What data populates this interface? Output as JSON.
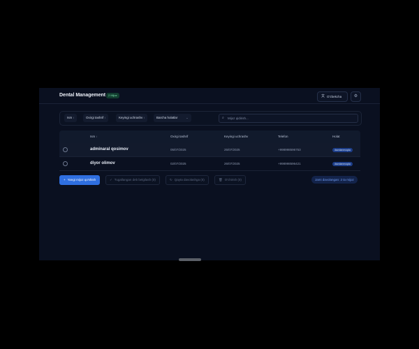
{
  "header": {
    "title": "Dental Management",
    "badge": "2 Mijoz",
    "language_label": "O'zbekcha",
    "language_icon": "translate-icon",
    "settings_icon": "gear-icon"
  },
  "filters": {
    "buttons": [
      "Ism",
      "Oxirgi tashrif",
      "Keyingi uchrashv"
    ],
    "status_select": "Barcha holatlar",
    "search_placeholder": "Mijoz qidirish..."
  },
  "table": {
    "headers": [
      "Ism",
      "Oxirgi tashrif",
      "Keyingi uchrashv",
      "Telefon",
      "Holat"
    ],
    "rows": [
      {
        "name": "adminaral qosimov",
        "last_visit": "05/07/2025",
        "next_visit": "25/07/2025",
        "phone": "+998998596753",
        "status": "davolanmoqda"
      },
      {
        "name": "diyor olimov",
        "last_visit": "02/07/2025",
        "next_visit": "26/07/2025",
        "phone": "+998998596421",
        "status": "davolanmoqda"
      }
    ]
  },
  "actions": {
    "add": "Yangi mijoz qo'shish",
    "finish": "Tugallangan deb belgilash (0)",
    "retreat": "Qayta davolashga (0)",
    "delete": "O'chirish (0)",
    "total": "Jami davolangan: 2 ta mijoz"
  },
  "colors": {
    "accent": "#2f6fe0",
    "background": "#0a1020",
    "status_badge": "#1e3f8a",
    "count_badge": "#123d2f"
  }
}
